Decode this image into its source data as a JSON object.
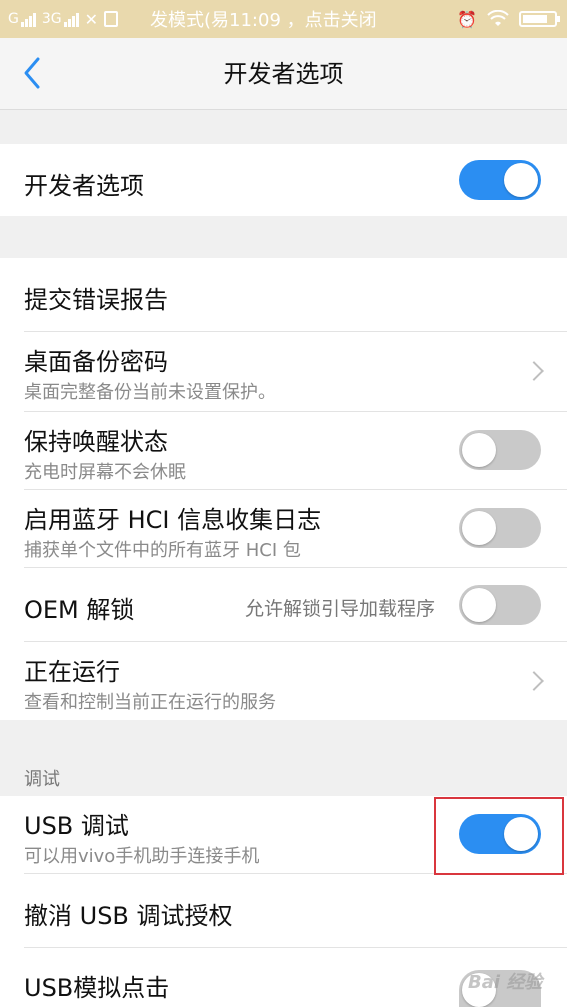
{
  "status_bar": {
    "carrier1": "G",
    "carrier2": "3G",
    "center_text": "发模式(易11:09 ，点击关闭"
  },
  "header": {
    "title": "开发者选项"
  },
  "master": {
    "label": "开发者选项",
    "enabled": true
  },
  "items": [
    {
      "title": "提交错误报告"
    },
    {
      "title": "桌面备份密码",
      "subtitle": "桌面完整备份当前未设置保护。"
    },
    {
      "title": "保持唤醒状态",
      "subtitle": "充电时屏幕不会休眠",
      "enabled": false
    },
    {
      "title": "启用蓝牙 HCI 信息收集日志",
      "subtitle": "捕获单个文件中的所有蓝牙 HCI 包",
      "enabled": false
    },
    {
      "title": "OEM 解锁",
      "subtitle": "允许解锁引导加载程序",
      "enabled": false
    },
    {
      "title": "正在运行",
      "subtitle": "查看和控制当前正在运行的服务"
    }
  ],
  "debug_group": {
    "label": "调试",
    "items": [
      {
        "title": "USB 调试",
        "subtitle": "可以用vivo手机助手连接手机",
        "enabled": true
      },
      {
        "title": "撤消 USB 调试授权"
      },
      {
        "title": "USB模拟点击"
      }
    ]
  },
  "watermark": "Bai 经验",
  "colors": {
    "accent": "#2b8ef2",
    "toggle_off": "#c9c9c9",
    "highlight": "#d9363e",
    "status_bar": "#e9d9ad"
  }
}
